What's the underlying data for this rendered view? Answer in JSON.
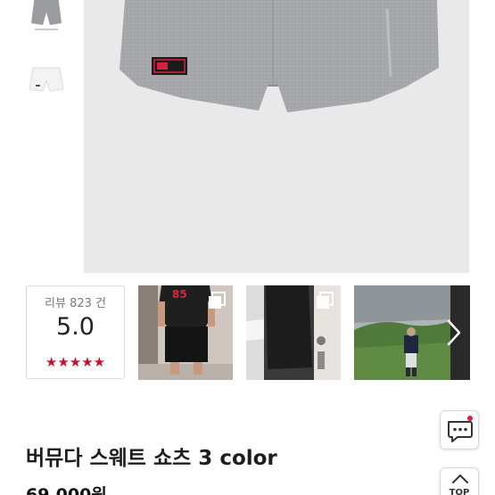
{
  "product": {
    "title": "버뮤다 스웨트 쇼츠 3 color",
    "price": "69,000원",
    "patch_text": "REGISTERED"
  },
  "reviews": {
    "count_label": "리뷰 823 건",
    "score": "5.0",
    "stars": "★★★★★",
    "star_color": "#c8102e"
  },
  "colors": {
    "accent": "#c8102e",
    "badge_dot": "#e0203a"
  },
  "buttons": {
    "top_label": "TOP"
  },
  "icons": {
    "chat": "chat-icon",
    "next": "chevron-right-icon",
    "top": "chevron-up-icon",
    "multi_photo": "multi-photo-icon"
  }
}
